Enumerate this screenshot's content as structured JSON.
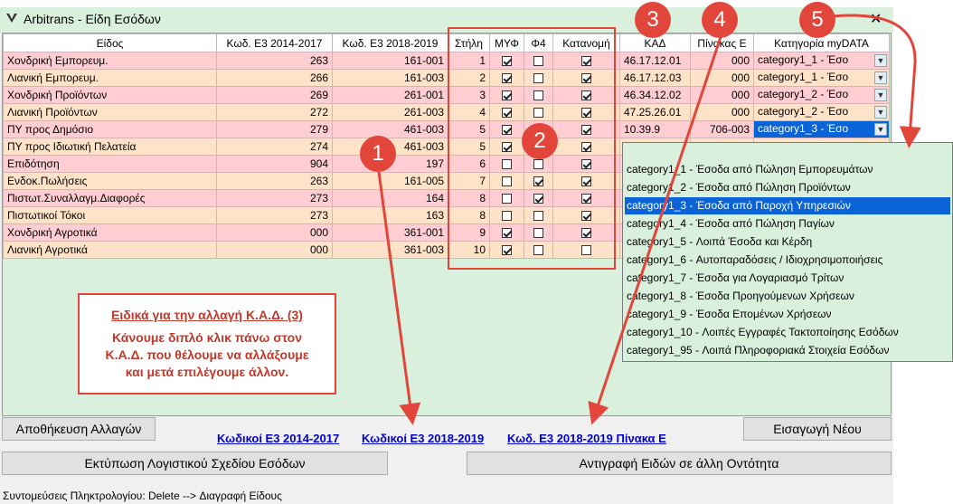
{
  "window": {
    "title": "Arbitrans - Είδη Εσόδων",
    "close_label": "✕"
  },
  "grid": {
    "headers": [
      "Είδος",
      "Κωδ. Ε3 2014-2017",
      "Κωδ. Ε3 2018-2019",
      "Στήλη",
      "ΜΥΦ",
      "Φ4",
      "Κατανομή",
      "ΚΑΔ",
      "Πίνακας Ε",
      "Κατηγορία myDATA"
    ],
    "rows": [
      {
        "name": "Χονδρική Εμπορευμ.",
        "e3_old": "263",
        "e3_new": "161-001",
        "stili": "1",
        "myf": true,
        "f4": false,
        "katanomi": true,
        "kad": "46.17.12.01",
        "pinakas": "000",
        "category": "category1_1  - Έσο"
      },
      {
        "name": "Λιανική Εμπορευμ.",
        "e3_old": "266",
        "e3_new": "161-003",
        "stili": "2",
        "myf": true,
        "f4": false,
        "katanomi": true,
        "kad": "46.17.12.03",
        "pinakas": "000",
        "category": "category1_1  - Έσο"
      },
      {
        "name": "Χονδρική Προϊόντων",
        "e3_old": "269",
        "e3_new": "261-001",
        "stili": "3",
        "myf": true,
        "f4": false,
        "katanomi": true,
        "kad": "46.34.12.02",
        "pinakas": "000",
        "category": "category1_2  - Έσο"
      },
      {
        "name": "Λιανική Προϊόντων",
        "e3_old": "272",
        "e3_new": "261-003",
        "stili": "4",
        "myf": true,
        "f4": false,
        "katanomi": true,
        "kad": "47.25.26.01",
        "pinakas": "000",
        "category": "category1_2  - Έσο"
      },
      {
        "name": "ΠΥ προς Δημόσιο",
        "e3_old": "279",
        "e3_new": "461-003",
        "stili": "5",
        "myf": true,
        "f4": false,
        "katanomi": true,
        "kad": "10.39.9",
        "pinakas": "706-003",
        "category": "category1_3  - Έσο"
      },
      {
        "name": "ΠΥ προς Ιδιωτική Πελατεία",
        "e3_old": "274",
        "e3_new": "461-003",
        "stili": "5",
        "myf": true,
        "f4": false,
        "katanomi": true,
        "kad": "",
        "pinakas": "",
        "category": ""
      },
      {
        "name": "Επιδότηση",
        "e3_old": "904",
        "e3_new": "197",
        "stili": "6",
        "myf": false,
        "f4": false,
        "katanomi": true,
        "kad": "",
        "pinakas": "",
        "category": ""
      },
      {
        "name": "Ενδοκ.Πωλήσεις",
        "e3_old": "263",
        "e3_new": "161-005",
        "stili": "7",
        "myf": false,
        "f4": true,
        "katanomi": true,
        "kad": "",
        "pinakas": "",
        "category": ""
      },
      {
        "name": "Πιστωτ.Συναλλαγμ.Διαφορές",
        "e3_old": "273",
        "e3_new": "164",
        "stili": "8",
        "myf": false,
        "f4": true,
        "katanomi": true,
        "kad": "",
        "pinakas": "",
        "category": ""
      },
      {
        "name": "Πιστωτικοί Τόκοι",
        "e3_old": "273",
        "e3_new": "163",
        "stili": "8",
        "myf": false,
        "f4": false,
        "katanomi": true,
        "kad": "",
        "pinakas": "",
        "category": ""
      },
      {
        "name": "Χονδρική Αγροτικά",
        "e3_old": "000",
        "e3_new": "361-001",
        "stili": "9",
        "myf": true,
        "f4": false,
        "katanomi": true,
        "kad": "",
        "pinakas": "",
        "category": ""
      },
      {
        "name": "Λιανική Αγροτικά",
        "e3_old": "000",
        "e3_new": "361-003",
        "stili": "10",
        "myf": true,
        "f4": false,
        "katanomi": false,
        "kad": "",
        "pinakas": "",
        "category": ""
      }
    ],
    "selected_row": 4
  },
  "dropdown": {
    "options": [
      "category1_1 - Έσοδα από Πώληση Εμπορευμάτων",
      "category1_2 - Έσοδα από Πώληση Προϊόντων",
      "category1_3 - Έσοδα από Παροχή Υπηρεσιών",
      "category1_4 - Έσοδα από Πώληση Παγίων",
      "category1_5 - Λοιπά Έσοδα και Κέρδη",
      "category1_6 - Αυτοπαραδόσεις / Ιδιοχρησιμοποιήσεις",
      "category1_7 - Έσοδα για Λογαριασμό Τρίτων",
      "category1_8 - Έσοδα Προηγούμενων Χρήσεων",
      "category1_9 - Έσοδα Επομένων Χρήσεων",
      "category1_10 - Λοιπές Εγγραφές Τακτοποίησης Εσόδων",
      "category1_95 - Λοιπά Πληροφοριακά Στοιχεία Εσόδων"
    ],
    "selected_index": 2
  },
  "buttons": {
    "save": "Αποθήκευση Αλλαγών",
    "new": "Εισαγωγή Νέου",
    "print": "Εκτύπωση Λογιστικού Σχεδίου Εσόδων",
    "copy": "Αντιγραφή Ειδών σε άλλη Οντότητα"
  },
  "links": {
    "e3_2014": "Κωδικοί Ε3 2014-2017",
    "e3_2018": "Κωδικοί Ε3 2018-2019",
    "e3_table_e": "Κωδ. Ε3 2018-2019 Πίνακα Ε"
  },
  "shortcuts": "Συντομεύσεις Πληκτρολογίου: Delete --> Διαγραφή Είδους",
  "note": {
    "title": "Ειδικά για την αλλαγή Κ.Α.Δ. (3)",
    "lines": [
      "Κάνουμε διπλό κλικ πάνω στον",
      "Κ.Α.Δ. που θέλουμε να αλλάξουμε",
      "και μετά επιλέγουμε άλλον."
    ]
  },
  "badges": [
    "1",
    "2",
    "3",
    "4",
    "5"
  ],
  "colors": {
    "row_rose": "#ffcdd2",
    "row_peach": "#ffe3c8",
    "selection": "#0a64d8",
    "annotation": "#e2463b",
    "link": "#0000cc"
  }
}
